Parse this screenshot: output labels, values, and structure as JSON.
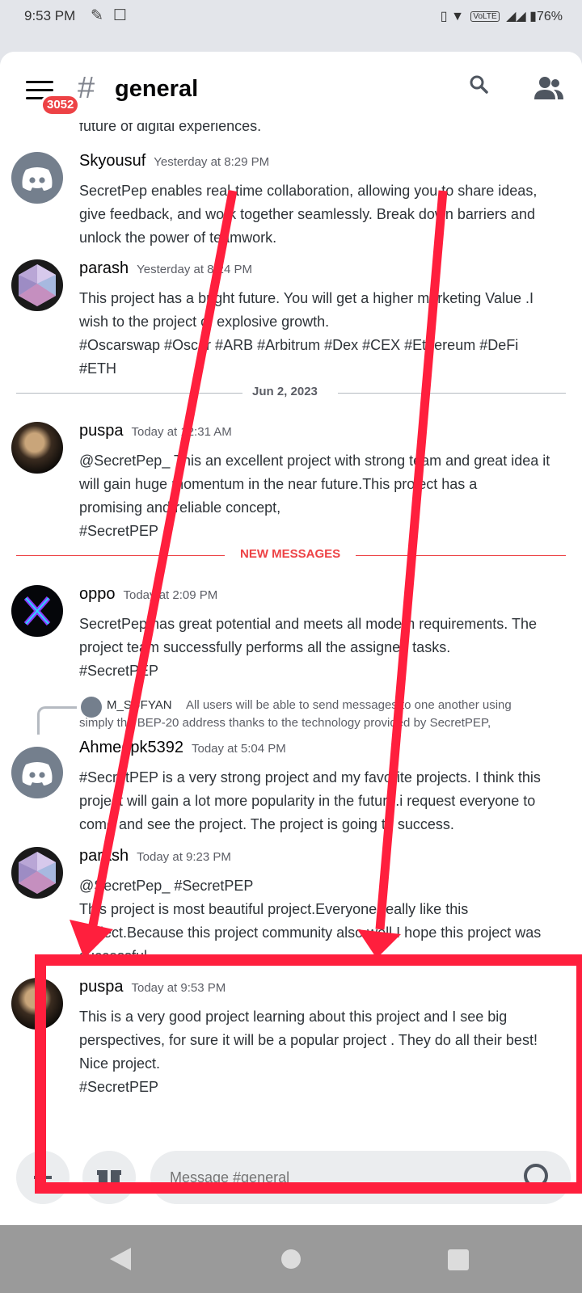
{
  "status_bar": {
    "time": "9:53 PM",
    "network": "VoLTE",
    "battery": "76%"
  },
  "header": {
    "channel_name": "general",
    "unread_badge": "3052",
    "icons": [
      "hamburger-menu-icon",
      "hash-icon",
      "search-icon",
      "members-icon"
    ]
  },
  "feed": {
    "cut_off_line": "future of digital experiences.",
    "messages": [
      {
        "author": "Skyousuf",
        "timestamp": "Yesterday at 8:29 PM",
        "avatar": "discord-default",
        "lines": [
          "SecretPep enables real-time collaboration, allowing you to share ideas,",
          "give feedback, and work together seamlessly. Break down barriers and",
          "unlock the power of teamwork."
        ]
      },
      {
        "author": "parash",
        "timestamp": "Yesterday at 8:24 PM",
        "avatar": "icosahedron",
        "lines": [
          "This project has a bright future. You will get a higher marketing Value .I",
          "wish to the project of explosive growth.",
          "#Oscarswap #Oscar #ARB #Arbitrum #Dex #CEX #Ethereum #DeFi",
          "#ETH"
        ]
      },
      {
        "author": "puspa",
        "timestamp": "Today at 12:31 AM",
        "avatar": "photo",
        "lines": [
          "@SecretPep_ This an excellent project with strong team and great idea it",
          "will gain huge momentum in the near future.This project has a",
          "promising and reliable concept,",
          "#SecretPEP"
        ]
      },
      {
        "author": "oppo",
        "timestamp": "Today at 2:09 PM",
        "avatar": "xyz-logo",
        "lines": [
          "SecretPep has great potential and meets all modern requirements. The",
          "project team successfully performs all the assigned tasks.",
          " #SecretPEP"
        ]
      },
      {
        "author": "Ahmedpk5392",
        "timestamp": "Today at 5:04 PM",
        "avatar": "discord-default",
        "lines": [
          "#SecretPEP is a very strong project and my favorite projects. I think this",
          "project will gain a lot more popularity in the future.i request everyone to",
          "come and see the project. The project is going to success."
        ]
      },
      {
        "author": "parash",
        "timestamp": "Today at 9:23 PM",
        "avatar": "icosahedron",
        "lines": [
          "@SecretPep_ #SecretPEP",
          "This project is most beautiful project.Everyone really like this",
          "project.Because this project community also well.I hope this project was",
          "successful."
        ]
      },
      {
        "author": "puspa",
        "timestamp": "Today at 9:53 PM",
        "avatar": "photo",
        "lines": [
          "This is a very good project learning about this project and I see big",
          "perspectives, for sure it will be a popular project . They do all their best!",
          "Nice project.",
          "#SecretPEP"
        ]
      }
    ],
    "date_divider": "Jun 2, 2023",
    "new_messages_divider": "NEW MESSAGES",
    "reply_preview": {
      "author": "M_SUFYAN",
      "text_line1": "All users will be able to send messages to one another using",
      "text_line2": "simply the BEP-20 address thanks to the technology provided by SecretPEP,"
    }
  },
  "composer": {
    "placeholder": "Message #general",
    "icons": [
      "plus-icon",
      "gift-icon",
      "emoji-icon"
    ]
  },
  "colors": {
    "accent_red_annotation": "#ff1f3d",
    "new_messages_red": "#ed4245",
    "discord_gray": "#747f8d"
  }
}
